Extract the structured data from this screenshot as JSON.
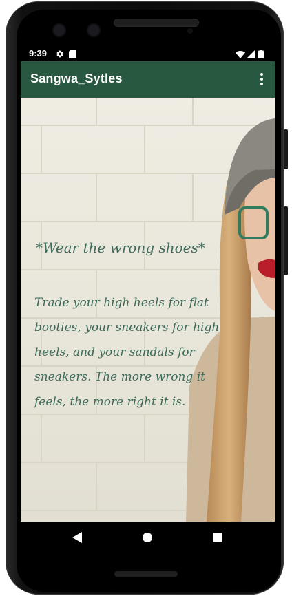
{
  "status_bar": {
    "time": "9:39",
    "icons": [
      "gear-icon",
      "sim-card-icon",
      "wifi-icon",
      "signal-icon",
      "battery-icon"
    ]
  },
  "app_bar": {
    "title": "Sangwa_Sytles",
    "overflow_icon": "more-vert-icon",
    "color": "#285840"
  },
  "content": {
    "quote_title": "*Wear the wrong shoes*",
    "quote_body": "Trade your high heels for flat booties, your sneakers for high heels, and your sandals for sneakers. The more wrong it feels, the more right it is.",
    "text_color": "#3c6a58"
  },
  "nav_bar": {
    "buttons": [
      "back-icon",
      "home-icon",
      "recents-icon"
    ]
  }
}
